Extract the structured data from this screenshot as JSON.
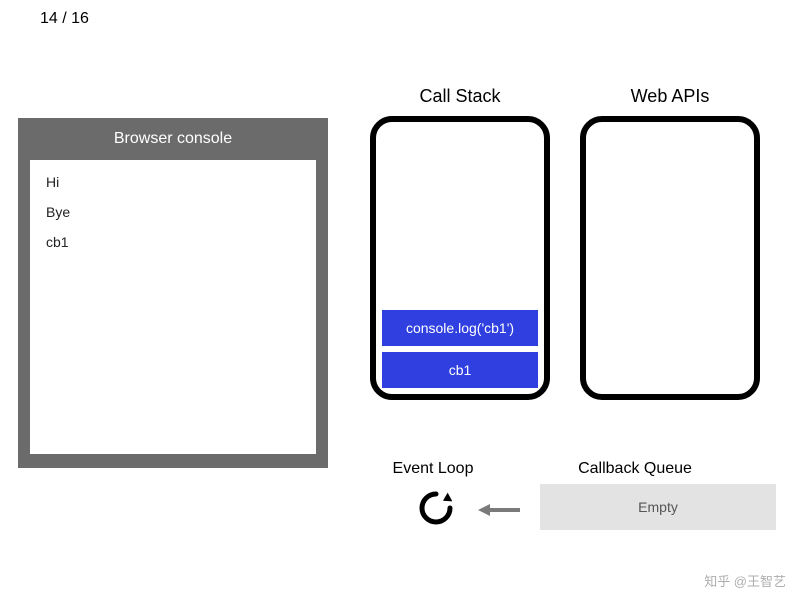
{
  "counter": {
    "text": "14 / 16"
  },
  "console": {
    "title": "Browser console",
    "lines": [
      "Hi",
      "Bye",
      "cb1"
    ]
  },
  "labels": {
    "call_stack": "Call Stack",
    "web_apis": "Web APIs",
    "event_loop": "Event Loop",
    "callback_queue": "Callback Queue"
  },
  "call_stack_items": [
    "cb1",
    "console.log('cb1')"
  ],
  "web_api_items": [],
  "callback_queue": {
    "status": "Empty"
  },
  "watermark": "知乎 @王智艺",
  "colors": {
    "stack_item": "#2f3fe0",
    "console_frame": "#6b6b6b",
    "queue_bg": "#e3e3e3"
  }
}
